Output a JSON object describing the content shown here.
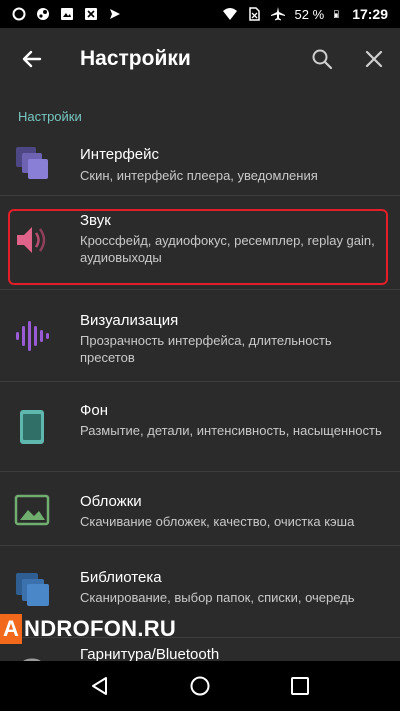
{
  "status_bar": {
    "left_icons": [
      "opera-icon",
      "steam-icon",
      "image-icon",
      "excel-icon",
      "send-icon"
    ],
    "battery_percent": "52 %",
    "time": "17:29"
  },
  "app_bar": {
    "title": "Настройки"
  },
  "section": {
    "title": "Настройки"
  },
  "items": [
    {
      "title": "Интерфейс",
      "subtitle": "Скин, интерфейс плеера, уведомления",
      "icon": "interface-layers-icon",
      "color": "#8a7fd6"
    },
    {
      "title": "Звук",
      "subtitle": "Кроссфейд, аудиофокус, ресемплер, replay gain, аудиовыходы",
      "icon": "speaker-icon",
      "color": "#e0638a"
    },
    {
      "title": "Визуализация",
      "subtitle": "Прозрачность интерфейса, длительность пресетов",
      "icon": "equalizer-bars-icon",
      "color": "#9a5bd6"
    },
    {
      "title": "Фон",
      "subtitle": "Размытие, детали, интенсивность, насыщенность",
      "icon": "phone-background-icon",
      "color": "#5fb8ad"
    },
    {
      "title": "Обложки",
      "subtitle": "Скачивание обложек, качество, очистка кэша",
      "icon": "image-cover-icon",
      "color": "#6fae6f"
    },
    {
      "title": "Библиотека",
      "subtitle": "Сканирование, выбор папок, списки, очередь",
      "icon": "library-stack-icon",
      "color": "#4a87c9"
    },
    {
      "title": "Гарнитура/Bluetooth",
      "subtitle": "",
      "icon": "headset-icon",
      "color": "#9a9a9a"
    }
  ],
  "watermark": {
    "letter": "A",
    "text": "NDROFON.RU"
  },
  "colors": {
    "accent": "#78c7c0",
    "highlight": "#e31e28",
    "background": "#2b2b2b"
  }
}
